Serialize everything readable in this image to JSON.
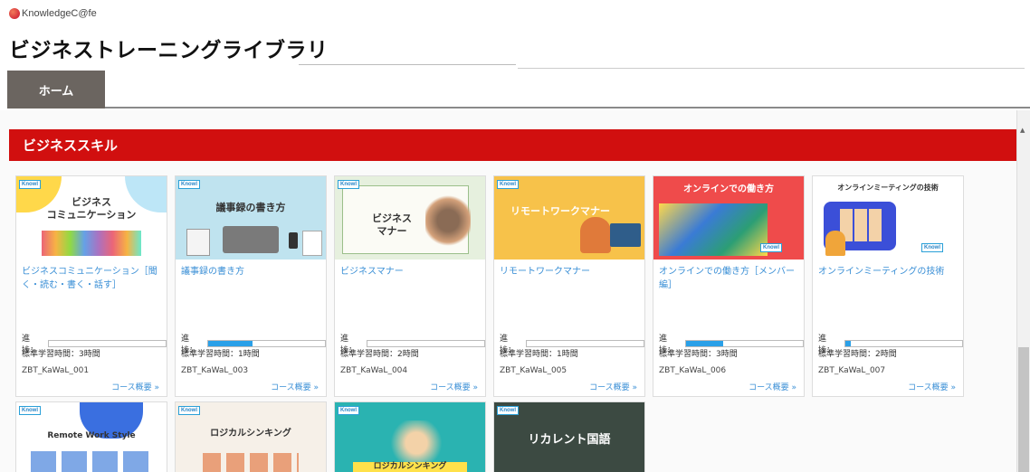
{
  "brand": {
    "name": "KnowledgeC@fe",
    "logo_icon": "coffee-cup-icon"
  },
  "page_title": "ビジネストレーニングライブラリ",
  "nav": {
    "home_tab": "ホーム"
  },
  "section": {
    "title": "ビジネススキル"
  },
  "labels": {
    "progress": "進捗：",
    "course_link": "コース概要 »"
  },
  "colors": {
    "section_red": "#d10f0f",
    "tab_gray": "#6b6560",
    "link_blue": "#3a8fd6",
    "progress_blue": "#2aa0e8"
  },
  "cards": [
    {
      "thumb_brand": "Knowl",
      "thumb_text": "ビジネス\nコミュニケーション",
      "title": "ビジネスコミュニケーション［聞く・読む・書く・話す］",
      "progress_pct": 0,
      "study_time": "標準学習時間：3時間",
      "code": "ZBT_KaWaL_001"
    },
    {
      "thumb_brand": "Knowl",
      "thumb_text": "議事録の書き方",
      "title": "議事録の書き方",
      "progress_pct": 38,
      "study_time": "標準学習時間：1時間",
      "code": "ZBT_KaWaL_003"
    },
    {
      "thumb_brand": "Knowl",
      "thumb_text": "ビジネス\nマナー",
      "title": "ビジネスマナー",
      "progress_pct": 0,
      "study_time": "標準学習時間：2時間",
      "code": "ZBT_KaWaL_004"
    },
    {
      "thumb_brand": "Knowl",
      "thumb_text": "リモートワークマナー",
      "title": "リモートワークマナー",
      "progress_pct": 0,
      "study_time": "標準学習時間：1時間",
      "code": "ZBT_KaWaL_005"
    },
    {
      "thumb_brand": "Knowl",
      "thumb_text": "オンラインでの働き方",
      "title": "オンラインでの働き方［メンバー編］",
      "progress_pct": 32,
      "study_time": "標準学習時間：3時間",
      "code": "ZBT_KaWaL_006"
    },
    {
      "thumb_brand": "Knowl",
      "thumb_text": "オンラインミーティングの技術",
      "title": "オンラインミーティングの技術",
      "progress_pct": 5,
      "study_time": "標準学習時間：2時間",
      "code": "ZBT_KaWaL_007"
    }
  ],
  "cards_row2": [
    {
      "thumb_brand": "Knowl",
      "thumb_text": "Remote Work Style"
    },
    {
      "thumb_brand": "Knowl",
      "thumb_text": "ロジカルシンキング"
    },
    {
      "thumb_brand": "Knowl",
      "thumb_text": "ロジカルシンキング"
    },
    {
      "thumb_brand": "Knowl",
      "thumb_text": "リカレント国語"
    }
  ]
}
